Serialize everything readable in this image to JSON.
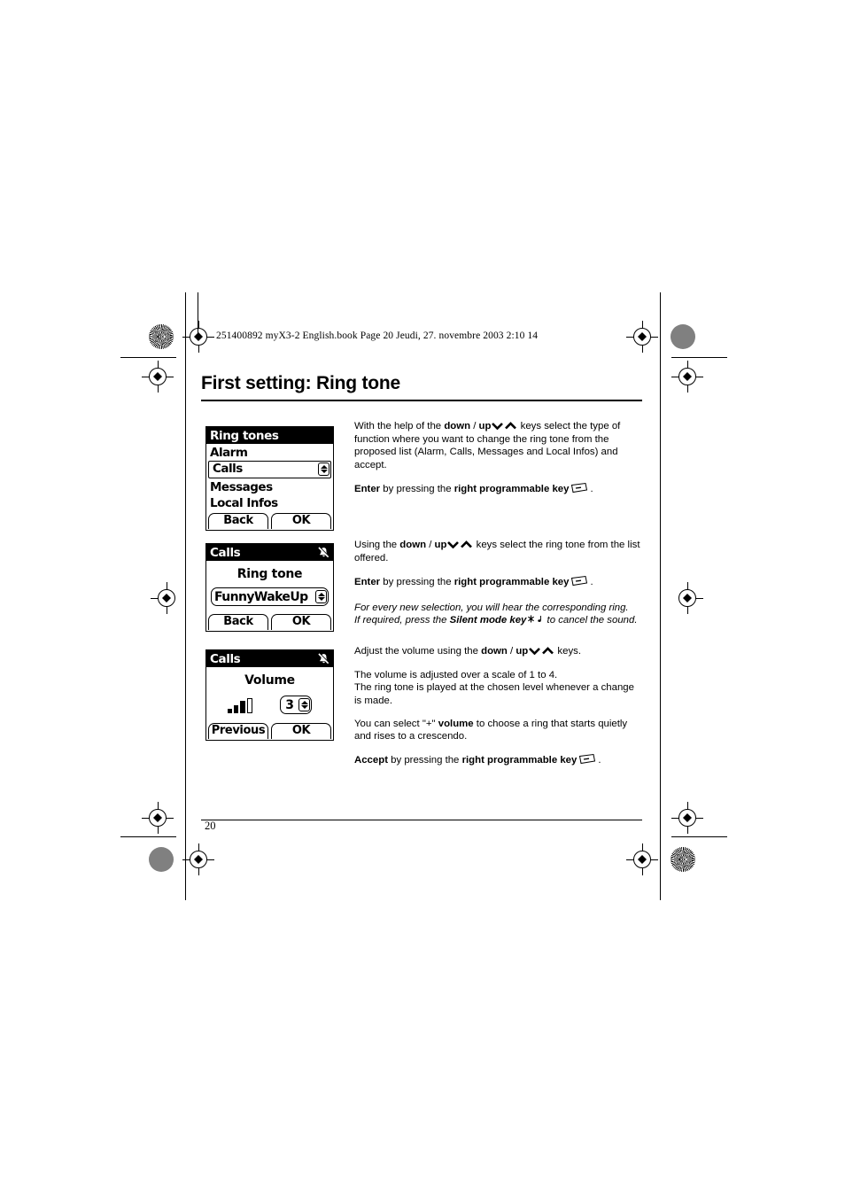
{
  "document": {
    "book_line": "251400892 myX3-2 English.book  Page 20  Jeudi, 27. novembre 2003  2:10 14",
    "title": "First setting: Ring tone",
    "page_number": "20"
  },
  "screens": [
    {
      "header": "Ring tones",
      "items": [
        "Alarm",
        "Calls",
        "Messages",
        "Local Infos"
      ],
      "selected": "Calls",
      "softkey_left": "Back",
      "softkey_right": "OK"
    },
    {
      "header": "Calls",
      "status_icon": "silent-mode-icon",
      "title": "Ring tone",
      "value": "FunnyWakeUp",
      "softkey_left": "Back",
      "softkey_right": "OK"
    },
    {
      "header": "Calls",
      "status_icon": "silent-mode-icon",
      "title": "Volume",
      "value": "3",
      "bars_filled": 3,
      "bars_total": 4,
      "softkey_left": "Previous",
      "softkey_right": "OK"
    }
  ],
  "text_blocks": {
    "block1": {
      "p1_a": "With the help of the ",
      "p1_b1": "down",
      "p1_sep": " / ",
      "p1_b2": "up",
      "p1_c": " keys select the type of function where you want to change the ring tone from the proposed list (Alarm, Calls, Messages and Local Infos) and accept.",
      "p2_b1": "Enter",
      "p2_a": " by pressing the ",
      "p2_b2": "right programmable key",
      "p2_end": "."
    },
    "block2": {
      "p1_a": "Using the ",
      "p1_b1": "down",
      "p1_sep": " / ",
      "p1_b2": "up",
      "p1_c": " keys select the ring tone  from the list offered.",
      "p2_b1": "Enter",
      "p2_a": " by pressing the ",
      "p2_b2": "right programmable key",
      "p2_end": ".",
      "p3_i1": "For every new selection, you will hear the corresponding ring.",
      "p3_i2": "If required, press the ",
      "p3_bi": "Silent mode key",
      "p3_i3": " to cancel the sound."
    },
    "block3": {
      "p1_a": "Adjust the volume using the ",
      "p1_b1": "down",
      "p1_sep": " / ",
      "p1_b2": "up",
      "p1_c": " keys.",
      "p2_l1": "The volume is adjusted over a scale of 1 to 4.",
      "p2_l2": "The ring tone is played at the chosen level whenever a change is made.",
      "p3_a": "You can select \"+\" ",
      "p3_b": "volume",
      "p3_c": " to choose a ring that starts quietly and rises to a crescendo.",
      "p4_b1": "Accept",
      "p4_a": " by pressing the ",
      "p4_b2": "right programmable key",
      "p4_end": "."
    }
  },
  "colors": {
    "ink": "#000000",
    "paper": "#ffffff",
    "reg_gray": "#808080"
  }
}
